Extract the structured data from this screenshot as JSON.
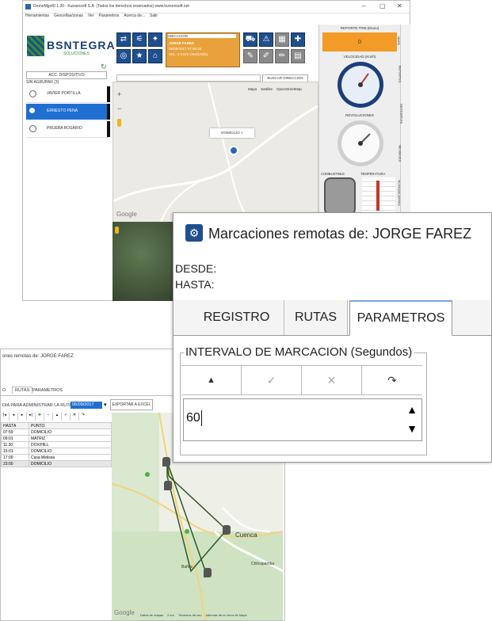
{
  "main_window": {
    "title": "DroneMgr#0 1.20 - Kursensoft S.A. (Todos los derechos reservados) www.kursensoft.net",
    "menu": [
      "Herramientas",
      "Geocellas/zonas",
      "Ver",
      "Parametros",
      "Acerca de...",
      "Salir"
    ],
    "logo_text": "BSNTEGRA",
    "logo_sub": "SOLUCIONES",
    "dispositivo_label": "ACC. DISPOSITIVO",
    "grupo_label": "SIN AGRUPAR (3)",
    "devices": [
      "JAVIER PORTILLA",
      "ERNESTO PENA",
      "PRUEBA ROSARIO"
    ],
    "ubicacion_label": "UBICACION",
    "info_lines": [
      "JORGE FAREZ",
      "06/09/2017 07:55:28",
      "VEL: 0 Km/H (Nv/0,0Gb)"
    ],
    "buscar_label": "BUSCAR DIRECCION",
    "map_modes": [
      "Mapa",
      "Satélite",
      "OpenStreetMap"
    ],
    "marker_label": "DOMICILIO",
    "right_panel": {
      "reporte_label": "REPORTE TRM (Diario)",
      "reporte_value": "0",
      "velocidad_label": "VELOCIDAD (Km/h)",
      "rpm_label": "REVOLUCIONES",
      "combustible_label": "COMBUSTIBLE",
      "temperatura_label": "TEMPERATURA",
      "side_tabs": [
        "MAPA",
        "REPORTES",
        "GEOCERCAS",
        "MENSAJES",
        "RUTAS/ALERTAS",
        "HISTORIAL"
      ]
    },
    "google_text": "Google"
  },
  "marcaciones_window": {
    "title": "Marcaciones remotas de: JORGE FAREZ",
    "desde_label": "DESDE:",
    "hasta_label": "HASTA:",
    "tabs": [
      "REGISTRO",
      "RUTAS",
      "PARAMETROS"
    ],
    "interval_label": "INTERVALO DE MARCACION (Segundos)",
    "nav_icons": [
      "arrow-up-icon",
      "check-icon",
      "close-icon",
      "refresh-icon"
    ],
    "nav_glyphs": [
      "▲",
      "✓",
      "✕",
      "↷"
    ],
    "interval_value": "60"
  },
  "rutas_window": {
    "title": "ones remotas de: JORGE FAREZ",
    "tabs": [
      "O",
      "RUTAS",
      "PARAMETROS"
    ],
    "dia_label": "DIA PARA ADMINISTRAR LA RUTA:",
    "dia_value": "06/09/2017",
    "export_label": "EXPORTAR A EXCEL",
    "columns": [
      "HASTA",
      "PUNTO"
    ],
    "rows": [
      [
        "07:59",
        "DOMICILIO"
      ],
      [
        "09:01",
        "MATRIZ"
      ],
      [
        "11:30",
        "DOX/HILL"
      ],
      [
        "15:01",
        "DOMICILIO"
      ],
      [
        "17:00",
        "Casa Melissa"
      ],
      [
        "23:00",
        "DOMICILIO"
      ]
    ],
    "map_city": "Cuenca",
    "map_places": [
      "Chilcapamba",
      "Baños"
    ],
    "google_text": "Google",
    "footer": [
      "Datos de mapas",
      "2 km",
      "Términos de uso",
      "Informar de un error de Maps"
    ]
  }
}
